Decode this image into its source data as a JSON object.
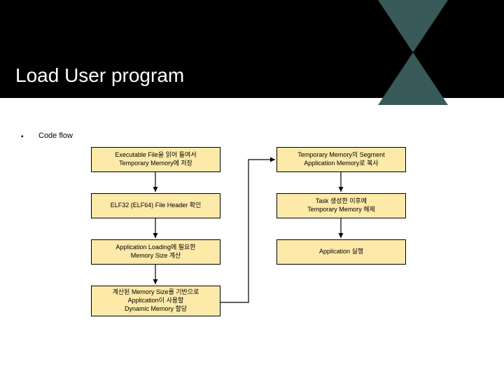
{
  "header": {
    "title": "Load User program"
  },
  "section": {
    "bullet": "▪",
    "label": "Code flow"
  },
  "flow": {
    "left": [
      "Executable File을 읽어 들여서\nTemporary Memory에 저장",
      "ELF32 (ELF64) File Header 확인",
      "Application Loading에 필요한\nMemory Size 계산",
      "계산된 Memory Size를 기반으로\nApplication이 사용할\nDynamic Memory 할당"
    ],
    "right": [
      "Temporary Memory의 Segment\nApplication Memory로 복사",
      "Task 생성한 이후에\nTemporary Memory 해제",
      "Application 실행"
    ]
  },
  "chart_data": {
    "type": "flowchart",
    "title": "Load User program — Code flow",
    "nodes": [
      {
        "id": "L1",
        "label": "Executable File을 읽어 들여서 Temporary Memory에 저장"
      },
      {
        "id": "L2",
        "label": "ELF32 (ELF64) File Header 확인"
      },
      {
        "id": "L3",
        "label": "Application Loading에 필요한 Memory Size 계산"
      },
      {
        "id": "L4",
        "label": "계산된 Memory Size를 기반으로 Application이 사용할 Dynamic Memory 할당"
      },
      {
        "id": "R1",
        "label": "Temporary Memory의 Segment Application Memory로 복사"
      },
      {
        "id": "R2",
        "label": "Task 생성한 이후에 Temporary Memory 해제"
      },
      {
        "id": "R3",
        "label": "Application 실행"
      }
    ],
    "edges": [
      {
        "from": "L1",
        "to": "L2"
      },
      {
        "from": "L2",
        "to": "L3"
      },
      {
        "from": "L3",
        "to": "L4"
      },
      {
        "from": "L4",
        "to": "R1"
      },
      {
        "from": "R1",
        "to": "R2"
      },
      {
        "from": "R2",
        "to": "R3"
      }
    ]
  }
}
